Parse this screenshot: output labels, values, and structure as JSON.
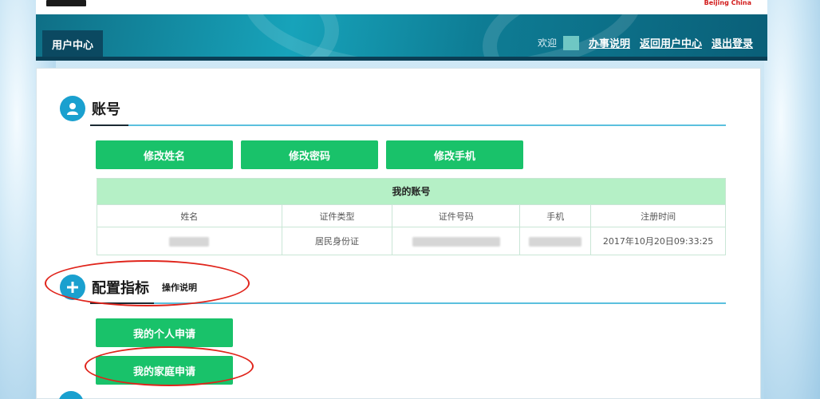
{
  "header": {
    "user_center_label": "用户中心",
    "welcome_text": "欢迎",
    "links": [
      "办事说明",
      "返回用户中心",
      "退出登录"
    ]
  },
  "account_section": {
    "title": "账号",
    "buttons": [
      "修改姓名",
      "修改密码",
      "修改手机"
    ],
    "table": {
      "caption": "我的账号",
      "columns": [
        "姓名",
        "证件类型",
        "证件号码",
        "手机",
        "注册时间"
      ],
      "row": {
        "name": "",
        "id_type": "居民身份证",
        "id_number": "",
        "phone": "",
        "registered_at": "2017年10月20日09:33:25"
      }
    }
  },
  "config_section": {
    "title": "配置指标",
    "subtitle": "操作说明",
    "buttons": [
      "我的个人申请",
      "我的家庭申请"
    ]
  },
  "colors": {
    "accent_green": "#19c26a",
    "table_header_green": "#b5f0c6",
    "icon_blue": "#1aa0cf",
    "header_teal": "#17a3ba",
    "annotation_red": "#e0241b"
  }
}
